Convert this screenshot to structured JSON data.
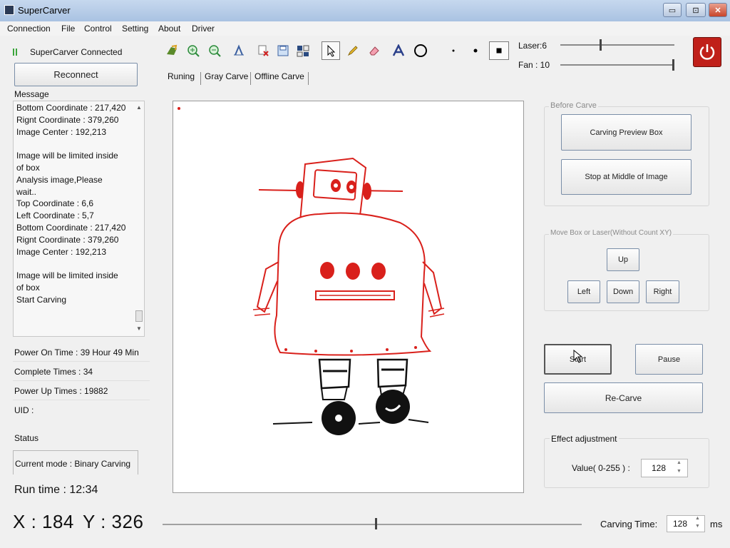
{
  "window": {
    "title": "SuperCarver",
    "btn_min": "▭",
    "btn_max": "⊡",
    "btn_close": "✕"
  },
  "menu": [
    "Connection",
    "File",
    "Control",
    "Setting",
    "About",
    "Driver"
  ],
  "connection": {
    "status": "SuperCarver Connected",
    "reconnect": "Reconnect",
    "status_color": "#3aa53a"
  },
  "message": {
    "label": "Message",
    "lines": [
      "Bottom Coordinate : 217,420",
      "Rignt Coordinate : 379,260",
      "Image Center : 192,213",
      "",
      "Image will be limited inside",
      "of box",
      "Analysis image,Please",
      "wait..",
      "Top Coordinate : 6,6",
      "Left Coordinate : 5,7",
      "Bottom Coordinate : 217,420",
      "Rignt Coordinate : 379,260",
      "Image Center : 192,213",
      "",
      "Image will be limited inside",
      "of box",
      "Start Carving"
    ]
  },
  "stats": {
    "power_on_time": "Power On Time : 39 Hour 49 Min",
    "complete_times": "Complete Times : 34",
    "power_up_times": "Power Up Times : 19882",
    "uid": "UID :"
  },
  "status": {
    "label": "Status",
    "mode": "Current mode : Binary Carving",
    "run_time": "Run time :  12:34"
  },
  "coords": {
    "x": "X : 184",
    "y": "Y : 326"
  },
  "toolbar": {
    "icons": [
      "open-icon",
      "zoom-in-icon",
      "zoom-out-icon",
      "flip-icon",
      "delete-icon",
      "save-icon",
      "grid-icon",
      "select-icon",
      "pencil-icon",
      "eraser-icon",
      "text-icon",
      "circle-icon",
      "dot-small-icon",
      "dot-medium-icon",
      "dot-large-icon"
    ]
  },
  "laser": {
    "label": "Laser:6",
    "level": 0.35
  },
  "fan": {
    "label": "Fan : 10",
    "level": 1.0
  },
  "tabs": [
    "Runing",
    "Gray Carve",
    "Offline Carve"
  ],
  "before_carve": {
    "label": "Before Carve",
    "preview": "Carving Preview Box",
    "stop_middle": "Stop at Middle of Image"
  },
  "move": {
    "label": "Move Box or Laser(Without Count XY)",
    "up": "Up",
    "left": "Left",
    "down": "Down",
    "right": "Right"
  },
  "controls": {
    "start": "Start",
    "pause": "Pause",
    "recarve": "Re-Carve"
  },
  "effect": {
    "label": "Effect adjustment",
    "value_label": "Value( 0-255 ) :",
    "value": "128"
  },
  "carving_time": {
    "label": "Carving Time:",
    "value": "128",
    "unit": "ms"
  },
  "progress": {
    "level": 0.51
  },
  "colors": {
    "accent": "#d9201b",
    "power": "#c0201a"
  }
}
